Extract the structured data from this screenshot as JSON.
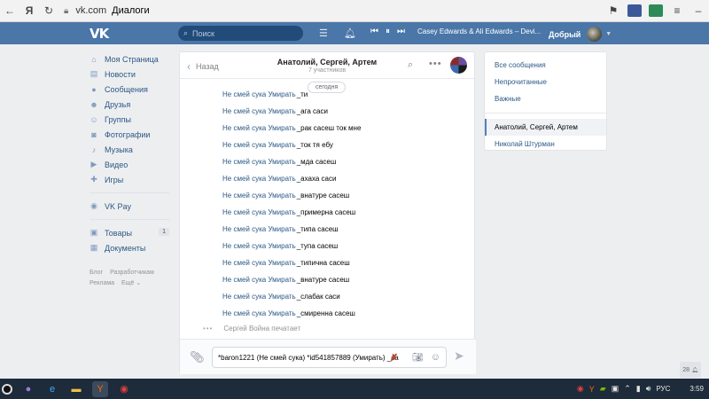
{
  "browser": {
    "host": "vk.com",
    "title": "Диалоги",
    "brand": "Я"
  },
  "header": {
    "logo": "VK",
    "search_placeholder": "Поиск",
    "track": "Casey Edwards & Ali Edwards – Devi...",
    "user_name": "Добрый"
  },
  "sidebar": {
    "items": [
      {
        "label": "Моя Страница",
        "icon": "home-icon",
        "glyph": "⌂"
      },
      {
        "label": "Новости",
        "icon": "news-icon",
        "glyph": "▤"
      },
      {
        "label": "Сообщения",
        "icon": "messages-icon",
        "glyph": "●"
      },
      {
        "label": "Друзья",
        "icon": "friends-icon",
        "glyph": "☻"
      },
      {
        "label": "Группы",
        "icon": "groups-icon",
        "glyph": "☺"
      },
      {
        "label": "Фотографии",
        "icon": "photos-icon",
        "glyph": "◙"
      },
      {
        "label": "Музыка",
        "icon": "music-icon",
        "glyph": "♪"
      },
      {
        "label": "Видео",
        "icon": "video-icon",
        "glyph": "▶"
      },
      {
        "label": "Игры",
        "icon": "games-icon",
        "glyph": "✚"
      }
    ],
    "vkpay": {
      "label": "VK Pay",
      "icon": "vkpay-icon",
      "glyph": "◉"
    },
    "extra": [
      {
        "label": "Товары",
        "icon": "goods-icon",
        "glyph": "▣",
        "badge": "1"
      },
      {
        "label": "Документы",
        "icon": "documents-icon",
        "glyph": "▦"
      }
    ],
    "footer": {
      "blog": "Блог",
      "developers": "Разработчикам",
      "ads": "Реклама",
      "more": "Ещё ⌄"
    }
  },
  "chat": {
    "back_label": "Назад",
    "title": "Анатолий, Сергей, Артем",
    "subtitle": "7 участников",
    "date_label": "сегодня",
    "messages": [
      {
        "author": "Не смей сука Умирать",
        "text": " _ти"
      },
      {
        "author": "Не смей сука Умирать",
        "text": " _ага саси"
      },
      {
        "author": "Не смей сука Умирать",
        "text": " _рак сасеш ток мне"
      },
      {
        "author": "Не смей сука Умирать",
        "text": " _ток тя ебу"
      },
      {
        "author": "Не смей сука Умирать",
        "text": " _мда сасеш"
      },
      {
        "author": "Не смей сука Умирать",
        "text": " _ахаха саси"
      },
      {
        "author": "Не смей сука Умирать",
        "text": " _внатуре сасеш"
      },
      {
        "author": "Не смей сука Умирать",
        "text": " _примерна сасеш"
      },
      {
        "author": "Не смей сука Умирать",
        "text": " _типа сасеш"
      },
      {
        "author": "Не смей сука Умирать",
        "text": " _тупа сасеш"
      },
      {
        "author": "Не смей сука Умирать",
        "text": " _типична сасеш"
      },
      {
        "author": "Не смей сука Умирать",
        "text": " _внатуре сасеш"
      },
      {
        "author": "Не смей сука Умирать",
        "text": " _слабак саси"
      },
      {
        "author": "Не смей сука Умирать",
        "text": " _смиренна сасеш"
      }
    ],
    "typing": "Сергей Война печатает",
    "composer_value": "*baron1221 (Не смей сука) *id541857889 (Умирать) _са"
  },
  "folders": {
    "top": [
      {
        "label": "Все сообщения"
      },
      {
        "label": "Непрочитанные"
      },
      {
        "label": "Важные"
      }
    ],
    "dialogs": [
      {
        "label": "Анатолий, Сергей, Артем",
        "active": true
      },
      {
        "label": "Николай Штурман",
        "active": false
      }
    ]
  },
  "corner_badge": "28",
  "taskbar": {
    "lang": "РУС",
    "time": "3:59"
  },
  "colors": {
    "header": "#4a76a8",
    "link": "#2a5885",
    "background": "#edeef0"
  }
}
